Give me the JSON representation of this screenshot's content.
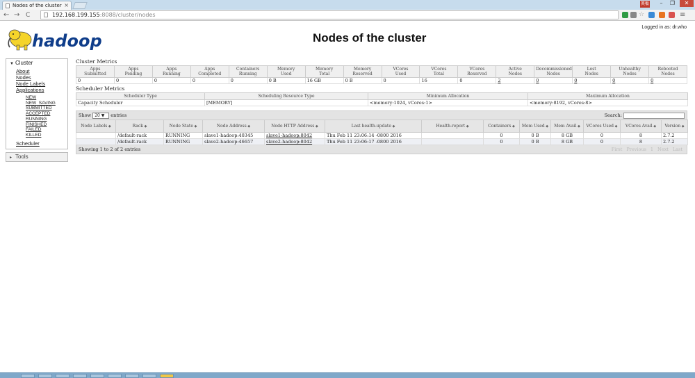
{
  "browser": {
    "tab_title": "Nodes of the cluster",
    "tab_close": "×",
    "url_host": "192.168.199.155",
    "url_rest": ":8088/cluster/nodes",
    "back": "←",
    "forward": "→",
    "reload": "C",
    "badge": "英板",
    "minimize": "–",
    "restore": "❐",
    "close": "✕",
    "colors": {
      "titlebar": "#c7dced",
      "badge": "#c0392b"
    }
  },
  "header": {
    "logo_text": "hadoop",
    "title": "Nodes of the cluster",
    "logged_in": "Logged in as: dr.who"
  },
  "nav": {
    "cluster_label": "Cluster",
    "links": [
      "About",
      "Nodes",
      "Node Labels",
      "Applications"
    ],
    "app_states": [
      "NEW",
      "NEW_SAVING",
      "SUBMITTED",
      "ACCEPTED",
      "RUNNING",
      "FINISHED",
      "FAILED",
      "KILLED"
    ],
    "scheduler": "Scheduler",
    "tools_label": "Tools"
  },
  "cluster_metrics": {
    "title": "Cluster Metrics",
    "headers": [
      [
        "Apps",
        "Submitted"
      ],
      [
        "Apps",
        "Pending"
      ],
      [
        "Apps",
        "Running"
      ],
      [
        "Apps",
        "Completed"
      ],
      [
        "Containers",
        "Running"
      ],
      [
        "Memory",
        "Used"
      ],
      [
        "Memory",
        "Total"
      ],
      [
        "Memory",
        "Reserved"
      ],
      [
        "VCores",
        "Used"
      ],
      [
        "VCores",
        "Total"
      ],
      [
        "VCores",
        "Reserved"
      ],
      [
        "Active",
        "Nodes"
      ],
      [
        "Decommissioned",
        "Nodes"
      ],
      [
        "Lost",
        "Nodes"
      ],
      [
        "Unhealthy",
        "Nodes"
      ],
      [
        "Rebooted",
        "Nodes"
      ]
    ],
    "values": [
      "0",
      "0",
      "0",
      "0",
      "0",
      "0 B",
      "16 GB",
      "0 B",
      "0",
      "16",
      "0",
      "2",
      "0",
      "0",
      "0",
      "0"
    ]
  },
  "scheduler_metrics": {
    "title": "Scheduler Metrics",
    "headers": [
      "Scheduler Type",
      "Scheduling Resource Type",
      "Minimum Allocation",
      "Maximum Allocation"
    ],
    "values": [
      "Capacity Scheduler",
      "[MEMORY]",
      "<memory:1024, vCores:1>",
      "<memory:8192, vCores:8>"
    ]
  },
  "nodes_table": {
    "show_label": "Show",
    "page_size": "20",
    "entries_label": "entries",
    "search_label": "Search:",
    "headers": [
      "Node Labels",
      "Rack",
      "Node State",
      "Node Address",
      "Node HTTP Address",
      "Last health-update",
      "Health-report",
      "Containers",
      "Mem Used",
      "Mem Avail",
      "VCores Used",
      "VCores Avail",
      "Version"
    ],
    "rows": [
      [
        "",
        "/default-rack",
        "RUNNING",
        "slave1-hadoop:40345",
        "slave1-hadoop:8042",
        "Thu Feb 11 23:06:14 -0800 2016",
        "",
        "0",
        "0 B",
        "8 GB",
        "0",
        "8",
        "2.7.2"
      ],
      [
        "",
        "/default-rack",
        "RUNNING",
        "slave2-hadoop:46657",
        "slave2-hadoop:8042",
        "Thu Feb 11 23:06:17 -0800 2016",
        "",
        "0",
        "0 B",
        "8 GB",
        "0",
        "8",
        "2.7.2"
      ]
    ],
    "info": "Showing 1 to 2 of 2 entries",
    "pager": [
      "First",
      "Previous",
      "1",
      "Next",
      "Last"
    ]
  }
}
